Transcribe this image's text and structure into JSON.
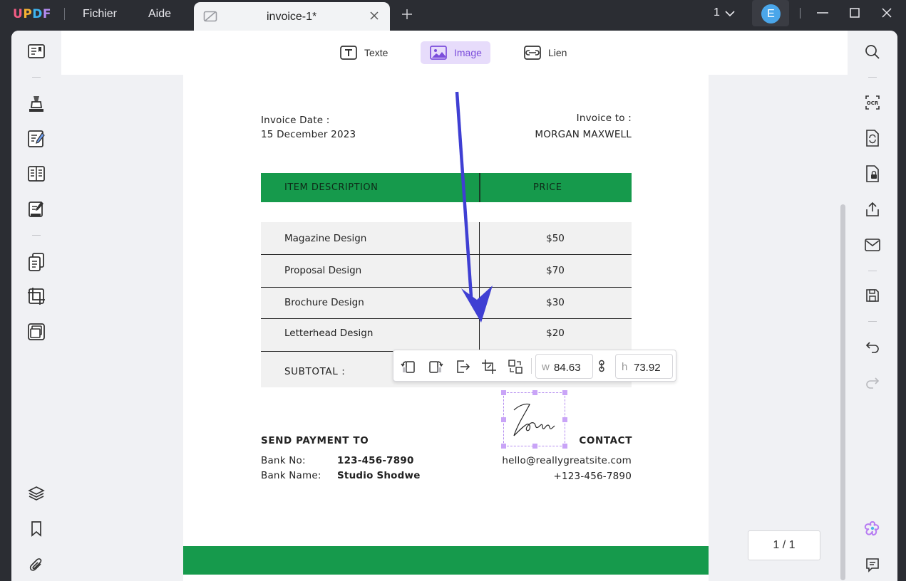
{
  "app": {
    "logo_letters": [
      "U",
      "P",
      "D",
      "F"
    ],
    "menu": [
      "Fichier",
      "Aide"
    ],
    "tab_title": "invoice-1*",
    "window_count": "1",
    "avatar_initial": "E"
  },
  "toolbar": {
    "text_label": "Texte",
    "image_label": "Image",
    "link_label": "Lien"
  },
  "invoice": {
    "date_label": "Invoice Date :",
    "date_value": "15 December 2023",
    "to_label": "Invoice to :",
    "to_value": "MORGAN MAXWELL",
    "col_desc": "ITEM DESCRIPTION",
    "col_price": "PRICE",
    "items": [
      {
        "desc": "Magazine Design",
        "price": "$50"
      },
      {
        "desc": "Proposal Design",
        "price": "$70"
      },
      {
        "desc": "Brochure Design",
        "price": "$30"
      },
      {
        "desc": "Letterhead Design",
        "price": "$20"
      }
    ],
    "subtotal_label": "SUBTOTAL :",
    "send_payment_heading": "SEND PAYMENT TO",
    "bank_no_label": "Bank No:",
    "bank_no_value": "123-456-7890",
    "bank_name_label": "Bank Name:",
    "bank_name_value": "Studio Shodwe",
    "contact_heading": "CONTACT",
    "contact_email": "hello@reallygreatsite.com",
    "contact_phone": "+123-456-7890"
  },
  "image_toolbar": {
    "w_prefix": "w",
    "w_value": "84.63",
    "h_prefix": "h",
    "h_value": "73.92"
  },
  "pagination": {
    "label": "1 / 1"
  },
  "colors": {
    "logo": [
      "#f25c84",
      "#f7b233",
      "#3fb3f0",
      "#b48cf2"
    ],
    "accent_purple": "#7b4ddb",
    "invoice_green": "#169a4c",
    "annotation_arrow": "#3f3fd3"
  }
}
